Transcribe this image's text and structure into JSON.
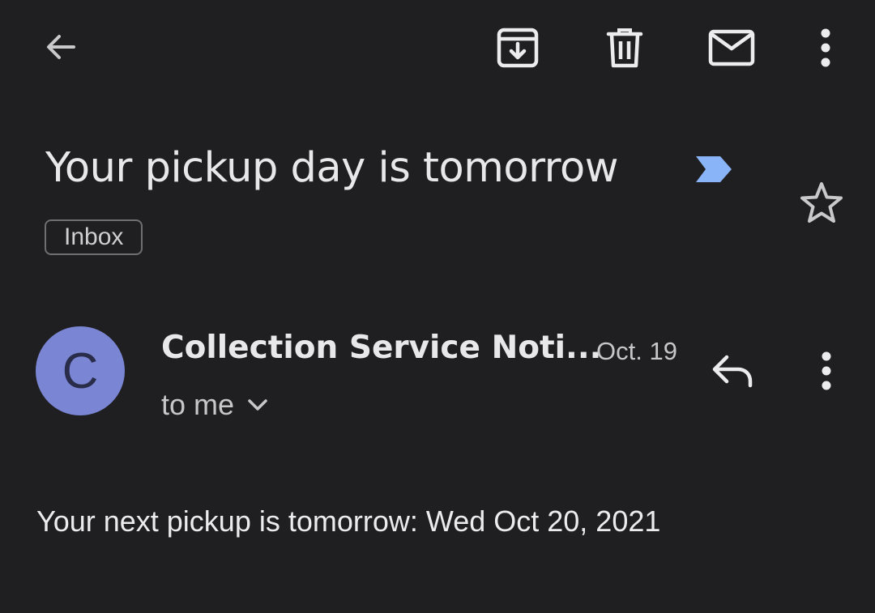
{
  "toolbar": {
    "back_icon": "arrow-back-icon",
    "archive_icon": "archive-icon",
    "delete_icon": "trash-icon",
    "mark_unread_icon": "mail-icon",
    "overflow_icon": "more-vert-icon"
  },
  "email": {
    "subject": "Your pickup day is tomorrow",
    "importance_icon": "important-marker-icon",
    "importance_color": "#8ab4f8",
    "label": "Inbox",
    "starred": false
  },
  "sender": {
    "avatar_letter": "C",
    "avatar_color": "#7a86d4",
    "name": "Collection Service Noti...",
    "date": "Oct. 19",
    "recipients": "to me"
  },
  "body": {
    "text": "Your next pickup is tomorrow: Wed Oct 20, 2021"
  }
}
